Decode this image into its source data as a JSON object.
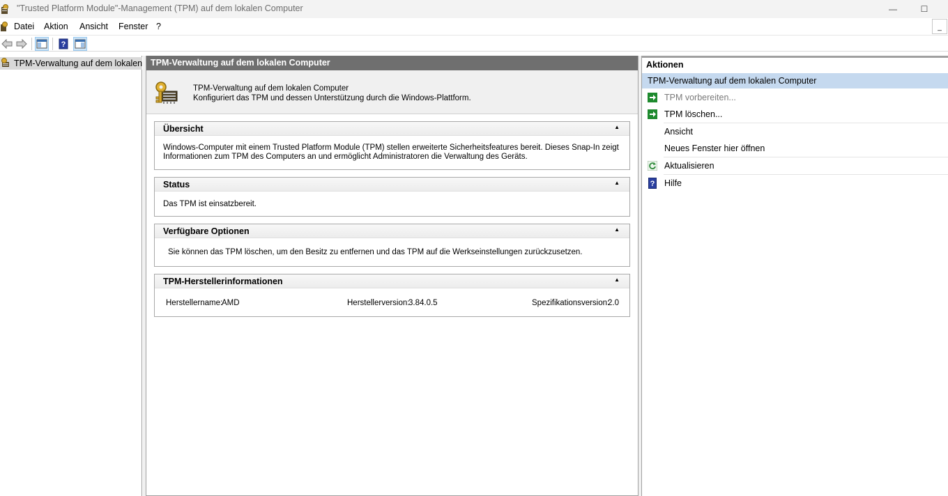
{
  "window": {
    "title": "\"Trusted Platform Module\"-Management (TPM) auf dem lokalen Computer",
    "minimize_glyph": "—",
    "maximize_glyph": "☐"
  },
  "menu": {
    "items": [
      "Datei",
      "Aktion",
      "Ansicht",
      "Fenster",
      "?"
    ],
    "mdi_glyph": "_"
  },
  "toolbar": {
    "buttons": [
      "back-arrow-icon",
      "forward-arrow-icon",
      "show-hide-console-tree-icon",
      "help-icon",
      "show-hide-action-pane-icon"
    ]
  },
  "tree": {
    "root_label": "TPM-Verwaltung auf dem lokalen Computer"
  },
  "center": {
    "header": "TPM-Verwaltung auf dem lokalen Computer",
    "intro_line1": "TPM-Verwaltung auf dem lokalen Computer",
    "intro_line2": "Konfiguriert das TPM und dessen Unterstützung durch die Windows-Plattform.",
    "sections": {
      "overview": {
        "title": "Übersicht",
        "text_line1": "Windows-Computer mit einem Trusted Platform Module (TPM) stellen erweiterte Sicherheitsfeatures bereit. Dieses Snap-In zeigt",
        "text_line2": "Informationen zum TPM des Computers an und ermöglicht Administratoren die Verwaltung des Geräts."
      },
      "status": {
        "title": "Status",
        "text": "Das TPM ist einsatzbereit."
      },
      "options": {
        "title": "Verfügbare Optionen",
        "text": "Sie können das TPM löschen, um den Besitz zu entfernen und das TPM auf die Werkseinstellungen zurückzusetzen."
      },
      "manufacturer": {
        "title": "TPM-Herstellerinformationen",
        "name_label": "Herstellername:",
        "name_value": "AMD",
        "version_label": "Herstellerversion:",
        "version_value": "3.84.0.5",
        "spec_label": "Spezifikationsversion:",
        "spec_value": "2.0"
      }
    },
    "collapse_glyph": "▲"
  },
  "actions": {
    "header": "Aktionen",
    "selected": "TPM-Verwaltung auf dem lokalen Computer",
    "items": [
      {
        "label": "TPM vorbereiten...",
        "icon": "green-arrow-icon",
        "disabled": true
      },
      {
        "label": "TPM löschen...",
        "icon": "green-arrow-icon",
        "disabled": false
      },
      {
        "label": "Ansicht",
        "icon": "",
        "disabled": false
      },
      {
        "label": "Neues Fenster hier öffnen",
        "icon": "",
        "disabled": false
      },
      {
        "label": "Aktualisieren",
        "icon": "refresh-icon",
        "disabled": false
      },
      {
        "label": "Hilfe",
        "icon": "help-icon",
        "disabled": false
      }
    ]
  },
  "colors": {
    "center_header_bg": "#6f6f6f",
    "action_selected_bg": "#c5d9ef",
    "tree_selected_bg": "#d9d9d9",
    "green_action": "#1e8a2e",
    "help_blue": "#2a3fa0"
  }
}
